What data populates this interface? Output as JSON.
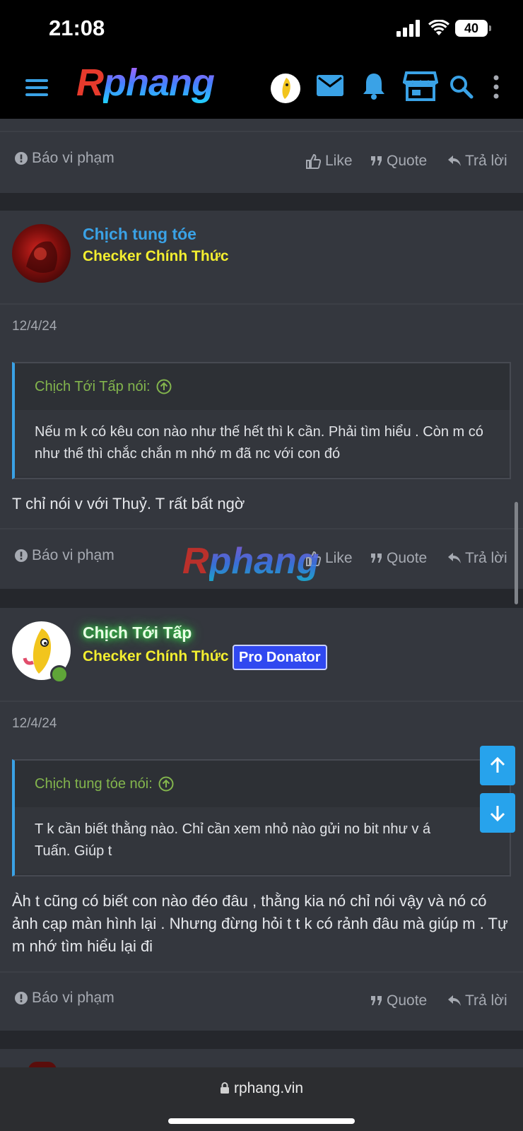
{
  "status": {
    "time": "21:08",
    "battery": "40"
  },
  "header": {
    "logo_r": "R",
    "logo_rest": "phang"
  },
  "watermark": {
    "r": "R",
    "rest": "phang"
  },
  "actions": {
    "report": "Báo vi phạm",
    "like": "Like",
    "quote": "Quote",
    "reply": "Trả lời"
  },
  "posts": [
    {
      "username": "Chịch tung tóe",
      "user_title": "Checker Chính Thức",
      "date": "12/4/24",
      "quote_author": "Chịch Tới Tấp nói:",
      "quote_text": "Nếu m k có kêu con nào như thế hết thì k cần. Phải tìm hiểu . Còn m có như thế thì chắc chắn m nhớ m đã nc với con đó",
      "body": "T chỉ nói v với Thuỷ. T rất bất ngờ"
    },
    {
      "username": "Chịch Tới Tấp",
      "user_title": "Checker Chính Thức",
      "badge": "Pro Donator",
      "date": "12/4/24",
      "quote_author": "Chịch tung tóe nói:",
      "quote_text": "T k cần biết thằng nào. Chỉ cần xem nhỏ nào gửi no bit như v á Tuấn. Giúp t",
      "body": "Àh t cũng có biết con nào đéo đâu , thằng kia nó chỉ nói vậy và nó có ảnh cạp màn hình lại . Nhưng đừng hỏi t t k có rảnh đâu mà giúp m . Tự m nhớ tìm hiểu lại đi"
    }
  ],
  "browser": {
    "url": "rphang.vin"
  },
  "colors": {
    "accent": "#3aa2e6",
    "user_title": "#f3ee2f",
    "username_blue": "#3aa2e6",
    "username_green_glow": "#35e04a",
    "quote_author": "#83b54d",
    "badge": "#3048f0"
  }
}
